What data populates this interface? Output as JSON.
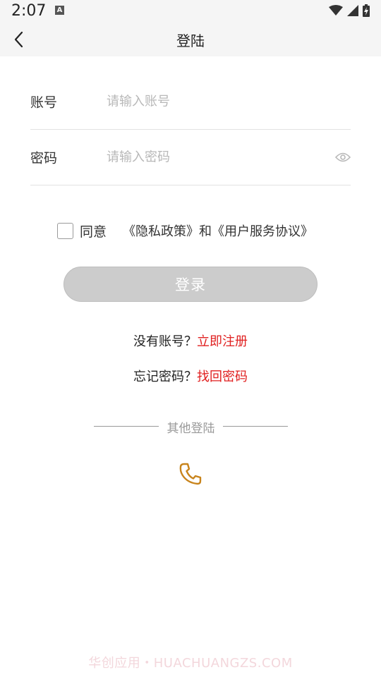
{
  "status_bar": {
    "time": "2:07",
    "indicator_icon": "keyboard-a-icon",
    "icons": [
      "wifi-icon",
      "signal-icon",
      "battery-charging-icon"
    ]
  },
  "header": {
    "back_icon": "back-arrow-icon",
    "title": "登陆"
  },
  "form": {
    "account": {
      "label": "账号",
      "placeholder": "请输入账号",
      "value": ""
    },
    "password": {
      "label": "密码",
      "placeholder": "请输入密码",
      "value": "",
      "toggle_icon": "eye-icon"
    }
  },
  "agreement": {
    "checked": false,
    "agree_label": "同意",
    "privacy_link": "《隐私政策》",
    "and_text": "和",
    "terms_link": "《用户服务协议》"
  },
  "login_button": "登录",
  "register_line": {
    "prefix": "没有账号？",
    "link": "立即注册"
  },
  "forgot_line": {
    "prefix": "忘记密码？",
    "link": "找回密码"
  },
  "other_login": {
    "label": "其他登陆",
    "phone_icon": "phone-icon"
  },
  "watermark": "华创应用・HUACHUANGZS.COM",
  "colors": {
    "background": "#ffffff",
    "bar_background": "#f5f5f5",
    "button_disabled": "#cccccc",
    "link_red": "#e02020",
    "phone_icon": "#c8841c",
    "placeholder": "#b8b8b8"
  }
}
